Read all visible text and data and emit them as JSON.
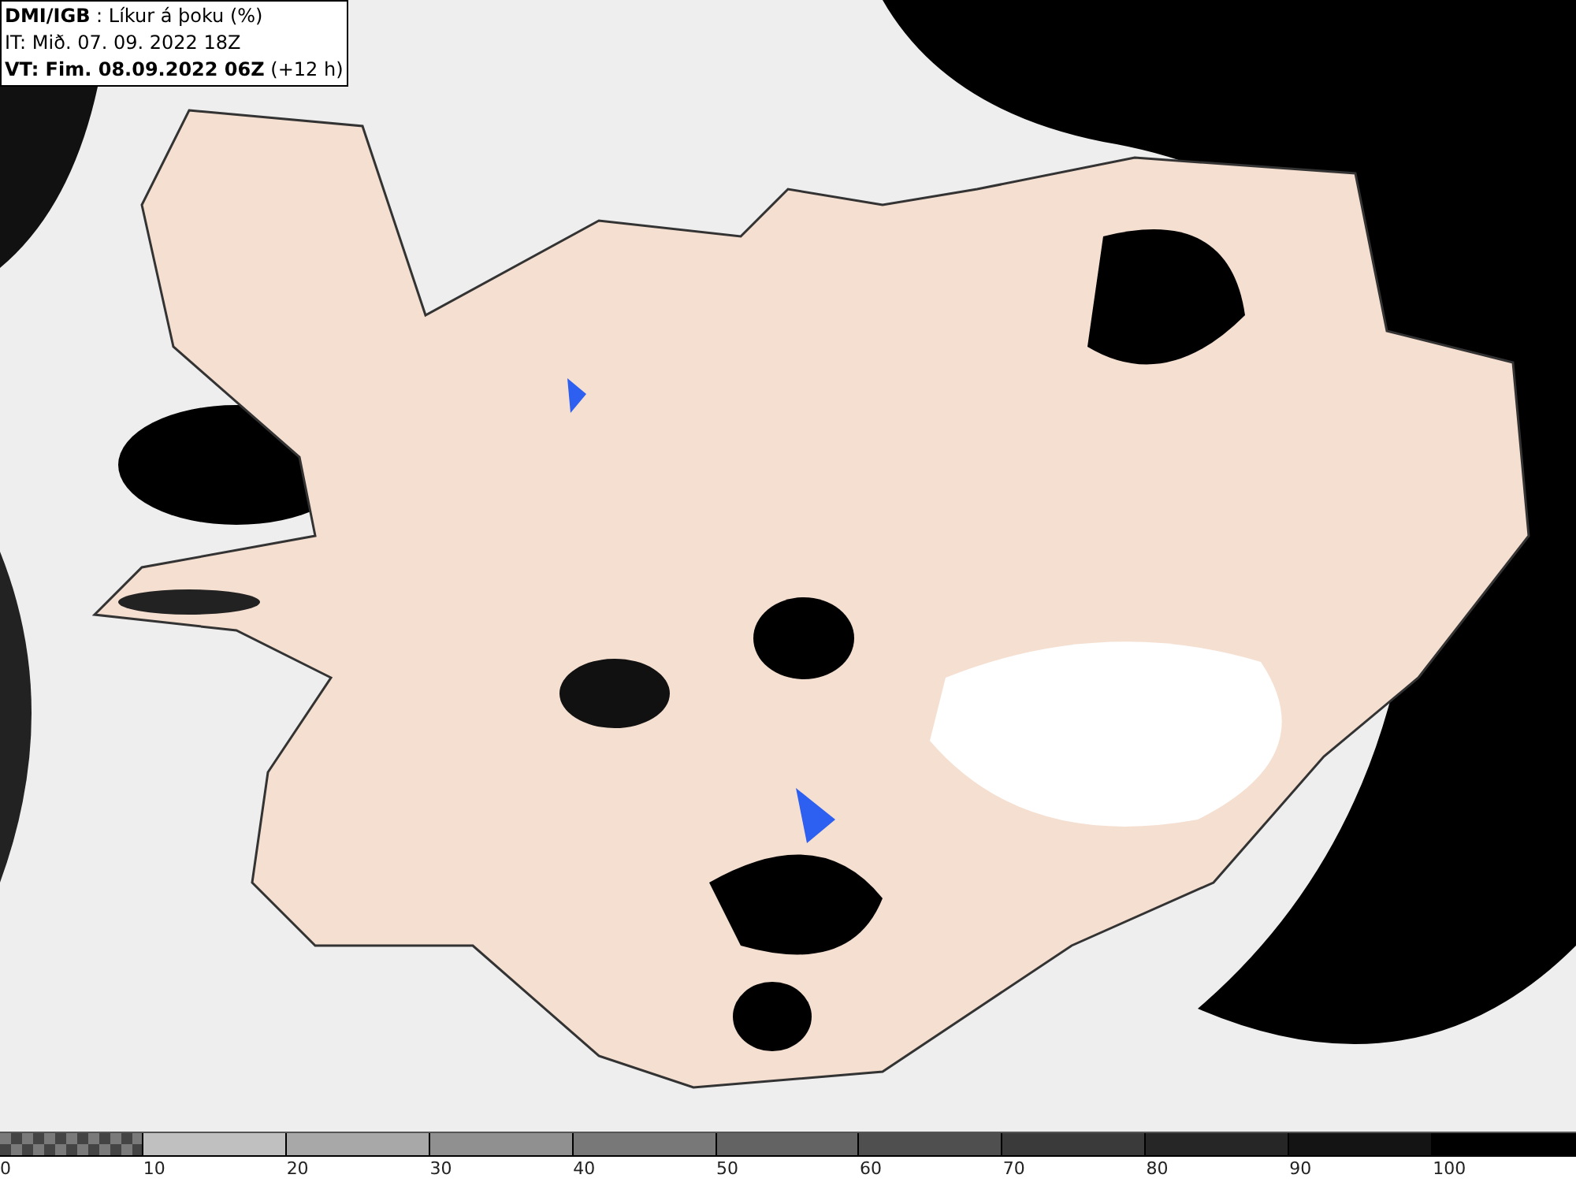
{
  "header": {
    "lines": [
      "**DMI/IGB** : Líkur á þoku (%)",
      "IT: Mið. 07. 09. 2022 18Z",
      "**VT: Fim. 08.09.2022 06Z** (+12 h)"
    ]
  },
  "legend": {
    "segments": [
      {
        "kind": "checker",
        "color": "#7a7a7a"
      },
      {
        "kind": "solid",
        "color": "#c0c0c0"
      },
      {
        "kind": "solid",
        "color": "#a8a8a8"
      },
      {
        "kind": "solid",
        "color": "#909090"
      },
      {
        "kind": "solid",
        "color": "#787878"
      },
      {
        "kind": "solid",
        "color": "#636363"
      },
      {
        "kind": "solid",
        "color": "#4f4f4f"
      },
      {
        "kind": "solid",
        "color": "#3a3a3a"
      },
      {
        "kind": "solid",
        "color": "#262626"
      },
      {
        "kind": "solid",
        "color": "#141414"
      },
      {
        "kind": "solid",
        "color": "#000000"
      }
    ],
    "ticks": [
      "0",
      "10",
      "20",
      "30",
      "40",
      "50",
      "60",
      "70",
      "80",
      "90",
      "100"
    ]
  }
}
